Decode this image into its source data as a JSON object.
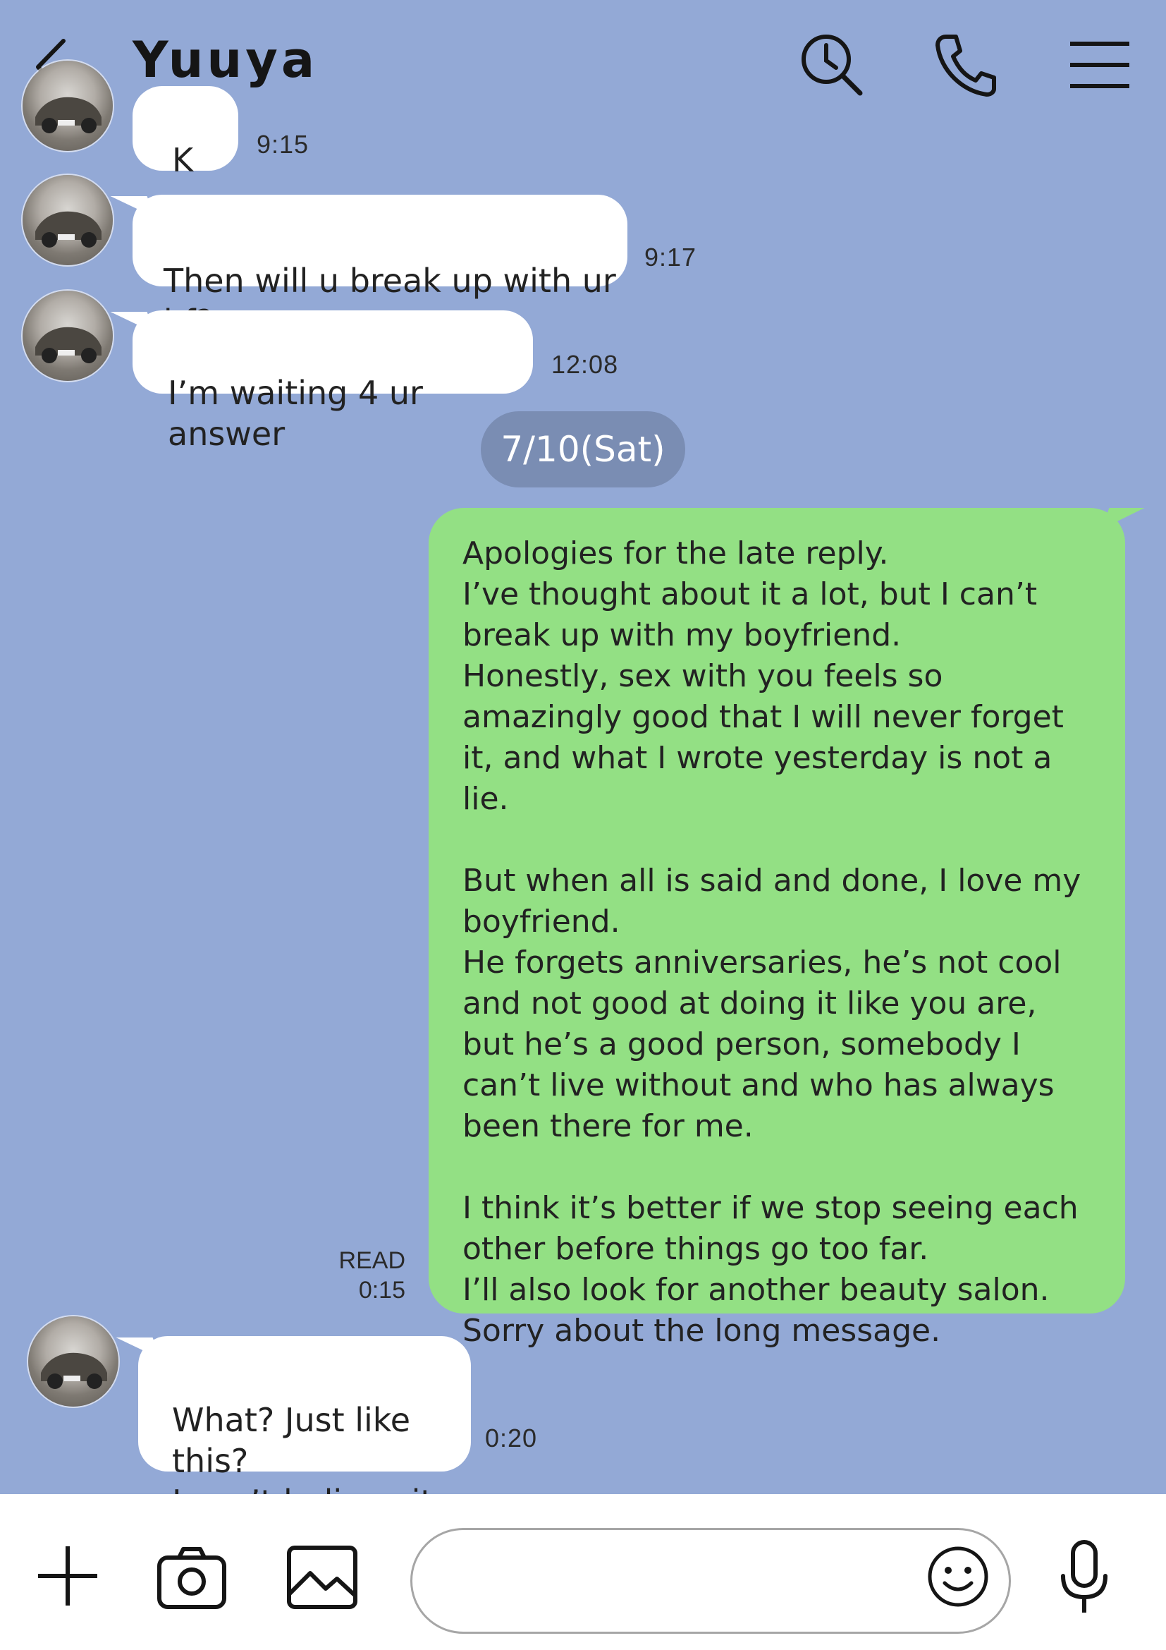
{
  "header": {
    "title": "Yuuya"
  },
  "messages": {
    "m1": {
      "text": "K",
      "time": "9:15"
    },
    "m2": {
      "text": "Then will u break up with ur bf?",
      "time": "9:17"
    },
    "m3": {
      "text": "I’m waiting 4 ur answer",
      "time": "12:08"
    },
    "date": "7/10(Sat)",
    "sent": {
      "p1": "Apologies for the late reply.\nI’ve thought about it a lot, but I can’t break up with my boyfriend.\nHonestly, sex with you feels so amazingly good that I will never forget it, and what I wrote yesterday is not a lie.",
      "p2": "But when all is said and done, I love my boyfriend.\nHe forgets anniversaries, he’s not cool and not good at doing it like you are, but he’s a good person, somebody I can’t live without and who has always been there for me.",
      "p3": "I think it’s better if we stop seeing each other before things go too far.\nI’ll also look for another beauty salon.\nSorry about the long message.",
      "read_label": "READ",
      "time": "0:15"
    },
    "m4": {
      "text": "What? Just like this?\nI can’t believe it.",
      "time": "0:20"
    }
  },
  "colors": {
    "background": "#93A9D6",
    "sent_bubble": "#93E084",
    "received_bubble": "#FFFFFF",
    "date_pill": "#7A8DB3"
  },
  "icons": [
    "back-arrow-icon",
    "search-history-icon",
    "phone-icon",
    "menu-icon",
    "plus-icon",
    "camera-icon",
    "image-icon",
    "emoji-icon",
    "mic-icon"
  ]
}
